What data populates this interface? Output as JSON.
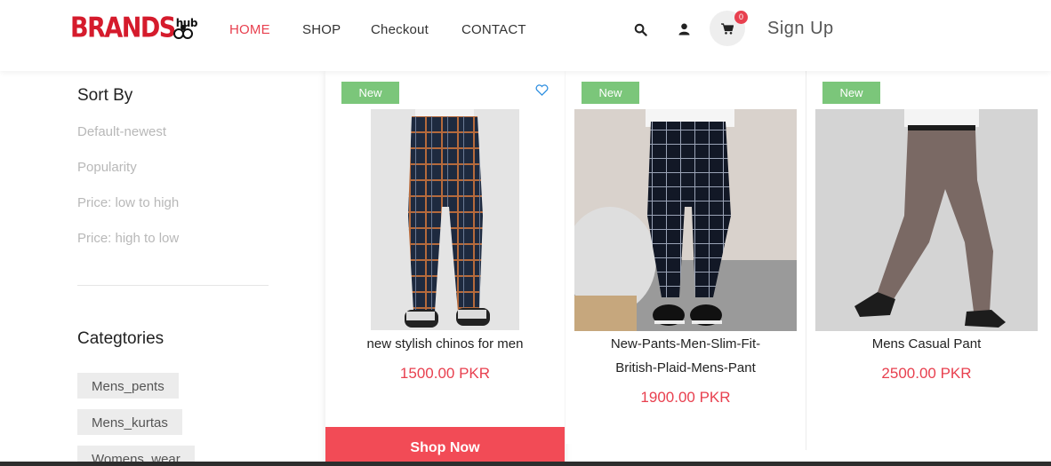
{
  "brand": {
    "name": "BRANDS",
    "suffix": "hub"
  },
  "nav": {
    "home": "HOME",
    "shop": "SHOP",
    "checkout": "Checkout",
    "contact": "CONTACT"
  },
  "header": {
    "cart_count": "0",
    "signup": "Sign Up"
  },
  "icons": {
    "search": "search-icon",
    "user": "user-icon",
    "cart": "cart-icon",
    "wishlist": "heart-icon"
  },
  "sidebar": {
    "sort_title": "Sort By",
    "sort_options": [
      "Default-newest",
      "Popularity",
      "Price: low to high",
      "Price: high to low"
    ],
    "categories_title": "Categtories",
    "categories": [
      "Mens_pents",
      "Mens_kurtas",
      "Womens_wear"
    ]
  },
  "products": [
    {
      "badge": "New",
      "name": "new stylish chinos for men",
      "price": "1500.00 PKR",
      "cta": "Shop Now"
    },
    {
      "badge": "New",
      "name_line1": "New-Pants-Men-Slim-Fit-",
      "name_line2": "British-Plaid-Mens-Pant",
      "price": "1900.00 PKR"
    },
    {
      "badge": "New",
      "name": "Mens Casual Pant",
      "price": "2500.00 PKR"
    }
  ],
  "colors": {
    "accent": "#e8404f",
    "brand": "#d51b2c",
    "badge": "#7bc67a",
    "shop_now": "#f24b56"
  }
}
